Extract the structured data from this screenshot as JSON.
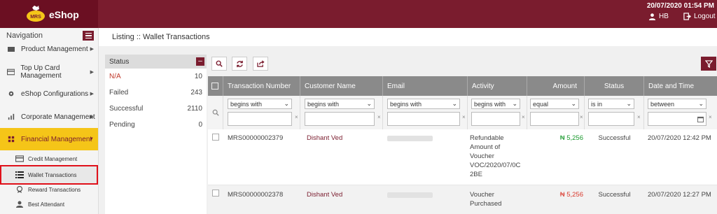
{
  "brand": {
    "name": "eShop",
    "logo_text": "MRS"
  },
  "topbar": {
    "datetime": "20/07/2020 01:54 PM",
    "user": "HB",
    "logout": "Logout"
  },
  "sidebar": {
    "title": "Navigation",
    "items": [
      {
        "label": "Product Management",
        "icon": "box-icon"
      },
      {
        "label": "Top Up Card Management",
        "icon": "card-icon"
      },
      {
        "label": "eShop Configurations",
        "icon": "gear-icon"
      },
      {
        "label": "Corporate Management",
        "icon": "bar-chart-icon"
      },
      {
        "label": "Financial Management",
        "icon": "finance-icon"
      }
    ],
    "sub_items": [
      {
        "label": "Credit Management",
        "icon": "credit-card-icon"
      },
      {
        "label": "Wallet Transactions",
        "icon": "list-icon"
      },
      {
        "label": "Reward Transactions",
        "icon": "reward-icon"
      },
      {
        "label": "Best Attendant",
        "icon": "user-icon"
      }
    ]
  },
  "breadcrumb": "Listing :: Wallet Transactions",
  "status_panel": {
    "title": "Status",
    "rows": [
      {
        "label": "N/A",
        "count": "10"
      },
      {
        "label": "Failed",
        "count": "243"
      },
      {
        "label": "Successful",
        "count": "2110"
      },
      {
        "label": "Pending",
        "count": "0"
      }
    ]
  },
  "grid": {
    "columns": [
      "Transaction Number",
      "Customer Name",
      "Email",
      "Activity",
      "Amount",
      "Status",
      "Date and Time"
    ],
    "filters": [
      "begins with",
      "begins with",
      "begins with",
      "begins with",
      "equal",
      "is in",
      "between"
    ],
    "rows": [
      {
        "number": "MRS00000002379",
        "customer": "Dishant Ved",
        "activity_lines": [
          "Refundable",
          "Amount of",
          "Voucher",
          "VOC/2020/07/0C",
          "2BE"
        ],
        "amount": "₦ 5,256",
        "amount_color": "#1a9a2e",
        "status": "Successful",
        "datetime": "20/07/2020 12:42 PM"
      },
      {
        "number": "MRS00000002378",
        "customer": "Dishant Ved",
        "activity_lines": [
          "Voucher",
          "Purchased"
        ],
        "amount": "₦ 5,256",
        "amount_color": "#d9382c",
        "status": "Successful",
        "datetime": "20/07/2020 12:27 PM"
      }
    ]
  },
  "colors": {
    "brand": "#7a1c2e",
    "accent": "#f5c518"
  }
}
